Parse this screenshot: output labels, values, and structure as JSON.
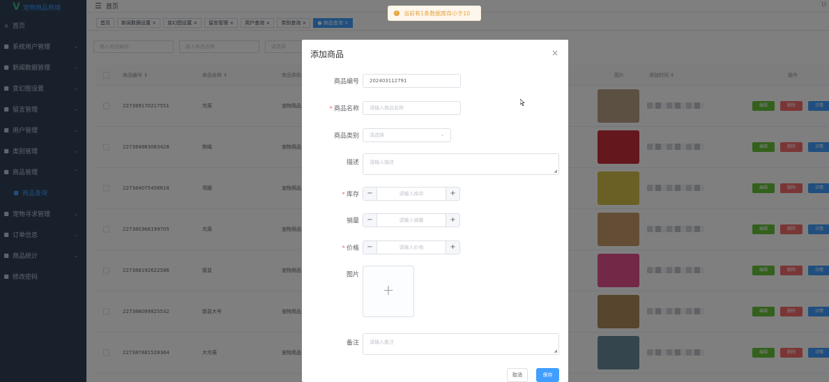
{
  "sidebar": {
    "brand": "宠物用品商城",
    "items": [
      {
        "label": "首页",
        "icon": "home-icon",
        "arrow": false
      },
      {
        "label": "系统用户管理",
        "icon": "grid-icon",
        "arrow": true
      },
      {
        "label": "新闻数据管理",
        "icon": "grid-icon",
        "arrow": true
      },
      {
        "label": "变幻图设置",
        "icon": "grid-icon",
        "arrow": true
      },
      {
        "label": "留言管理",
        "icon": "grid-icon",
        "arrow": true
      },
      {
        "label": "用户管理",
        "icon": "grid-icon",
        "arrow": true
      },
      {
        "label": "类别管理",
        "icon": "grid-icon",
        "arrow": true
      },
      {
        "label": "商品管理",
        "icon": "grid-icon",
        "arrow": true
      },
      {
        "label": "商品查询",
        "icon": "grid-icon",
        "arrow": false,
        "sub": true
      },
      {
        "label": "宠物寻求管理",
        "icon": "grid-icon",
        "arrow": true
      },
      {
        "label": "订单信息",
        "icon": "grid-icon",
        "arrow": true
      },
      {
        "label": "商品统计",
        "icon": "grid-icon",
        "arrow": true
      },
      {
        "label": "修改密码",
        "icon": "grid-icon",
        "arrow": false
      }
    ]
  },
  "topbar": {
    "breadcrumb": "首页",
    "right": "U"
  },
  "tags": [
    {
      "label": "首页",
      "active": false
    },
    {
      "label": "新闻数据设置 ×",
      "active": false
    },
    {
      "label": "变幻图设置 ×",
      "active": false
    },
    {
      "label": "留言管理 ×",
      "active": false
    },
    {
      "label": "用户查询 ×",
      "active": false
    },
    {
      "label": "类别查询 ×",
      "active": false
    },
    {
      "label": "● 商品查询 ×",
      "active": true
    }
  ],
  "filters": {
    "code_placeholder": "输入商品编号",
    "name_placeholder": "输入商品名称",
    "select_placeholder": "请选择"
  },
  "table": {
    "headers": {
      "code": "商品编号 ⇕",
      "name": "商品名称 ⇕",
      "category": "商品类别",
      "image": "图片",
      "time": "添加时间 ⇕",
      "ops": "操作"
    },
    "rows": [
      {
        "code": "227389170217551",
        "name": "鸟笼",
        "category": "宠物用品",
        "img": "#b9a084"
      },
      {
        "code": "227384963063428",
        "name": "狗绳",
        "category": "宠物用品",
        "img": "#c8313a"
      },
      {
        "code": "227384075456618",
        "name": "项圈",
        "category": "宠物用品",
        "img": "#d4c14a"
      },
      {
        "code": "227380366199705",
        "name": "鸟笼",
        "category": "宠物用品",
        "img": "#c89a6a"
      },
      {
        "code": "227388192622586",
        "name": "饭盆",
        "category": "宠物用品",
        "img": "#e4508c"
      },
      {
        "code": "227388099825532",
        "name": "饭盆大号",
        "category": "宠物用品",
        "img": "#b08a5a"
      },
      {
        "code": "227387881528364",
        "name": "大鸟笼",
        "category": "宠物用品",
        "img": "#6b8a9a"
      }
    ],
    "btn_edit": "编辑",
    "btn_delete": "删除",
    "btn_detail": "详情",
    "colors": {
      "edit": "#67c23a",
      "delete": "#f56c6c",
      "detail": "#409eff"
    }
  },
  "notice": {
    "text": "当前有1条数据库存小于10",
    "icon": "warning-icon"
  },
  "dialog": {
    "title": "添加商品",
    "close": "×",
    "fields": {
      "code": {
        "label": "商品编号",
        "value": "202403112791"
      },
      "name": {
        "label": "商品名称",
        "placeholder": "请输入商品名称"
      },
      "category": {
        "label": "商品类别",
        "placeholder": "请选择"
      },
      "desc": {
        "label": "描述",
        "placeholder": "请输入描述"
      },
      "stock": {
        "label": "库存",
        "placeholder": "请输入库存"
      },
      "sales": {
        "label": "销量",
        "placeholder": "请输入销量"
      },
      "price": {
        "label": "价格",
        "placeholder": "请输入价格"
      },
      "image": {
        "label": "图片"
      },
      "remark": {
        "label": "备注",
        "placeholder": "请输入备注"
      }
    },
    "cancel": "取消",
    "save": "保存",
    "accent": "#409eff"
  }
}
